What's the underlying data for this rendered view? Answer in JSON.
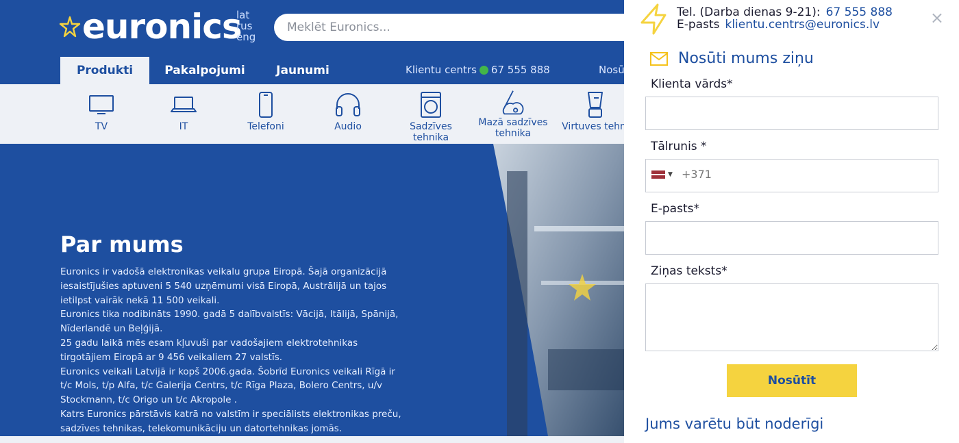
{
  "header": {
    "logo_text": "euronics",
    "languages": [
      "lat",
      "rus",
      "eng"
    ],
    "search_placeholder": "Meklēt Euronics..."
  },
  "tabs": [
    {
      "label": "Produkti",
      "active": true
    },
    {
      "label": "Pakalpojumi",
      "active": false
    },
    {
      "label": "Jaunumi",
      "active": false
    }
  ],
  "contact_bar": {
    "label": "Klientu centrs",
    "phone": "67 555 888",
    "send_label_partial": "Nosūt"
  },
  "categories": [
    {
      "label": "TV",
      "icon": "tv-icon"
    },
    {
      "label": "IT",
      "icon": "laptop-icon"
    },
    {
      "label": "Telefoni",
      "icon": "phone-icon"
    },
    {
      "label": "Audio",
      "icon": "headphones-icon"
    },
    {
      "label": "Sadzīves tehnika",
      "icon": "washing-machine-icon"
    },
    {
      "label": "Mazā sadzīves tehnika",
      "icon": "vacuum-cleaner-icon"
    },
    {
      "label": "Virtuves tehni",
      "icon": "blender-icon"
    }
  ],
  "about": {
    "title": "Par mums",
    "paragraphs": [
      "Euronics ir vadošā elektronikas veikalu grupa Eiropā. Šajā organizācijā iesaistījušies aptuveni 5 540 uzņēmumi visā Eiropā, Austrālijā un tajos ietilpst vairāk nekā 11 500 veikali.",
      "Euronics tika nodibināts 1990. gadā 5 dalībvalstīs: Vācijā, Itālijā, Spānijā, Nīderlandē un Beļģijā.",
      "25 gadu laikā mēs esam kļuvuši par vadošajiem elektrotehnikas tirgotājiem Eiropā ar 9 456 veikaliem 27 valstīs.",
      "Euronics veikali Latvijā ir kopš 2006.gada. Šobrīd Euronics veikali Rīgā ir t/c Mols, t/p Alfa, t/c Galerija Centrs, t/c Rīga Plaza, Bolero Centrs, u/v Stockmann, t/c Origo un t/c Akropole .",
      "Katrs Euronics pārstāvis katrā no valstīm ir speciālists elektronikas preču, sadzīves tehnikas, telekomunikāciju un datortehnikas jomās."
    ]
  },
  "contact_panel": {
    "tel_prefix": "Tel. (Darba dienas 9-21):",
    "tel_number": "67 555 888",
    "email_prefix": "E-pasts",
    "email": "klientu.centrs@euronics.lv",
    "close_symbol": "×",
    "title": "Nosūti mums ziņu",
    "fields": {
      "name_label": "Klienta vārds*",
      "phone_label": "Tālrunis *",
      "phone_placeholder": "+371",
      "email_label": "E-pasts*",
      "message_label": "Ziņas teksts*"
    },
    "submit_label": "Nosūtīt",
    "useful_heading": "Jums varētu būt noderīgi"
  },
  "colors": {
    "brand_blue": "#1e4fa0",
    "accent_yellow": "#f5d33f",
    "status_green": "#43b649"
  }
}
